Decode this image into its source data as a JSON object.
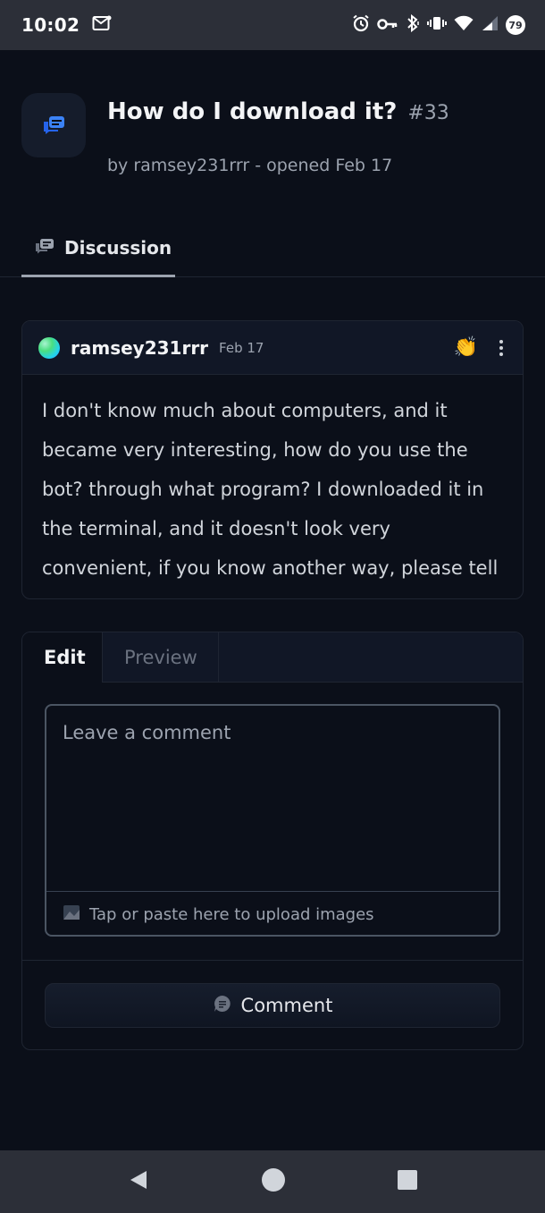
{
  "status_bar": {
    "time": "10:02",
    "battery": "79"
  },
  "issue": {
    "title": "How do I download it?",
    "number": "#33",
    "subtitle": "by ramsey231rrr - opened Feb 17"
  },
  "tabs": {
    "discussion_label": "Discussion"
  },
  "post": {
    "author": "ramsey231rrr",
    "date": "Feb 17",
    "reaction": "👏",
    "body": "I don't know much about computers, and it became very interesting, how do you use the bot? through what program? I downloaded it in the terminal, and it doesn't look very convenient, if you know another way, please tell me."
  },
  "editor": {
    "tab_edit": "Edit",
    "tab_preview": "Preview",
    "placeholder": "Leave a comment",
    "value": "",
    "upload_hint": "Tap or paste here to upload images",
    "comment_label": "Comment"
  },
  "colors": {
    "background": "#0b0f19",
    "accent_icon": "#3b82f6",
    "panel": "#111726"
  },
  "icons": {
    "app": "discussion-bubbles-icon",
    "tab": "discussion-icon",
    "upload": "image-icon",
    "comment": "comment-bubble-icon"
  }
}
